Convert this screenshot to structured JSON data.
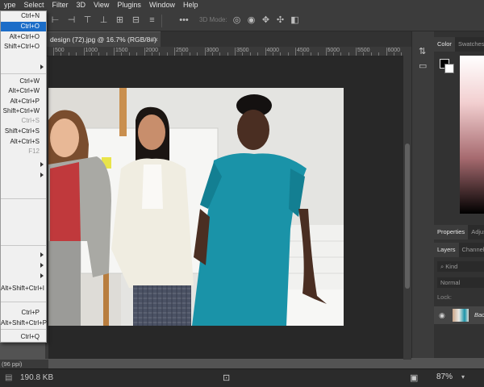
{
  "menubar": {
    "items": [
      "ype",
      "Select",
      "Filter",
      "3D",
      "View",
      "Plugins",
      "Window",
      "Help"
    ],
    "window_controls": [
      "–",
      "□",
      "✕"
    ]
  },
  "optionsbar": {
    "threed_label": "3D Mode:",
    "more_label": "•••"
  },
  "document": {
    "tab_title": "design (72).jpg @ 16.7% (RGB/8#)",
    "tab_close": "×"
  },
  "ruler": {
    "labels": [
      "500",
      "1000",
      "1500",
      "2000",
      "2500",
      "3000",
      "3500",
      "4000",
      "4500",
      "5000",
      "5500",
      "6000"
    ]
  },
  "file_menu": {
    "items": [
      {
        "shortcut": "Ctrl+N"
      },
      {
        "shortcut": "Ctrl+O",
        "highlighted": true
      },
      {
        "shortcut": "Alt+Ctrl+O"
      },
      {
        "shortcut": "Shift+Ctrl+O"
      },
      {
        "shortcut": "",
        "submenu": true
      },
      {
        "shortcut": "Ctrl+W"
      },
      {
        "shortcut": "Alt+Ctrl+W"
      },
      {
        "shortcut": "Alt+Ctrl+P"
      },
      {
        "shortcut": "Shift+Ctrl+W"
      },
      {
        "shortcut": "Ctrl+S",
        "disabled": true
      },
      {
        "shortcut": "Shift+Ctrl+S"
      },
      {
        "shortcut": "Alt+Ctrl+S"
      },
      {
        "shortcut": "F12",
        "disabled": true
      },
      {
        "shortcut": "",
        "submenu": true
      },
      {
        "shortcut": "",
        "submenu": true
      },
      {
        "shortcut": "",
        "submenu": true
      },
      {
        "shortcut": "",
        "submenu": true
      },
      {
        "shortcut": "",
        "submenu": true
      },
      {
        "shortcut": "Alt+Shift+Ctrl+I"
      },
      {
        "shortcut": "Ctrl+P"
      },
      {
        "shortcut": "Alt+Shift+Ctrl+P"
      },
      {
        "shortcut": "Ctrl+Q"
      }
    ]
  },
  "color_panel": {
    "tabs": [
      "Color",
      "Swatches"
    ]
  },
  "properties_panel": {
    "tabs": [
      "Properties",
      "Adjustments"
    ]
  },
  "layers_panel": {
    "tabs": [
      "Layers",
      "Channels"
    ],
    "kind_label": "Kind",
    "blend_mode": "Normal",
    "lock_label": "Lock:",
    "layer_name": "Background"
  },
  "statusbar": {
    "left_partial": "(96 ppi)",
    "file_size": "190.8 KB",
    "zoom": "87%"
  },
  "colors": {
    "app_bg": "#535353",
    "menu_highlight": "#1c6dc8",
    "dress_teal": "#1a93a8",
    "shirt_red": "#c0393c"
  }
}
